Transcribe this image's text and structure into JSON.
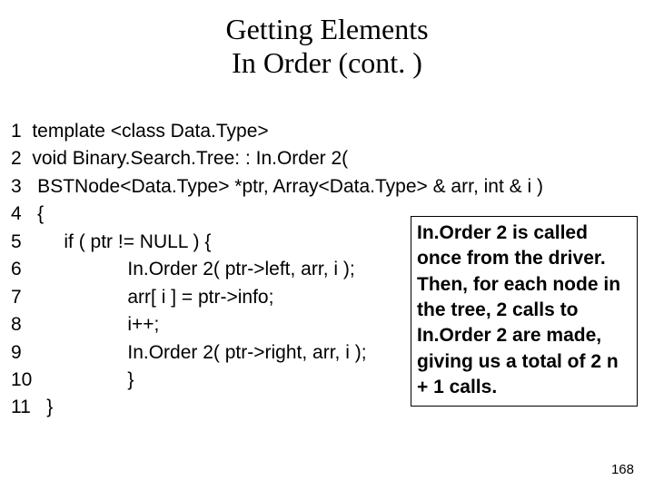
{
  "title_line1": "Getting Elements",
  "title_line2": "In Order (cont. )",
  "code": "1  template <class Data.Type>\n2  void Binary.Search.Tree: : In.Order 2(\n3   BSTNode<Data.Type> *ptr, Array<Data.Type> & arr, int & i )\n4   {\n5        if ( ptr != NULL ) {\n6                    In.Order 2( ptr->left, arr, i );\n7                    arr[ i ] = ptr->info;\n8                    i++;\n9                    In.Order 2( ptr->right, arr, i );\n10                  }\n11   }",
  "note": "In.Order 2 is called once from the driver. Then, for each node in the tree, 2 calls to In.Order 2 are made, giving us a total of 2 n + 1 calls.",
  "page_number": "168"
}
